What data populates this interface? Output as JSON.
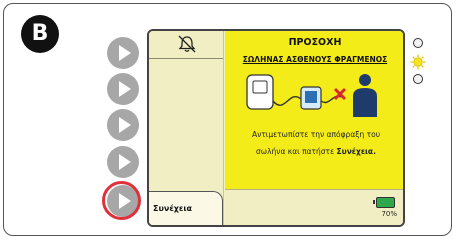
{
  "badge": {
    "letter": "B"
  },
  "screen": {
    "warning": {
      "title": "ΠΡΟΣΟΧΗ",
      "subtitle": "ΣΩΛΗΝΑΣ ΑΣΘΕΝΟΥΣ ΦΡΑΓΜΕΝΟΣ",
      "instruction_line1": "Αντιμετωπίστε την απόφραξη του",
      "instruction_line2_prefix": "σωλήνα και πατήστε ",
      "instruction_line2_bold": "Συνέχεια."
    },
    "continue_label": "Συνέχεια",
    "battery": {
      "percent": "70%",
      "level": 0.7
    }
  },
  "colors": {
    "warning_background": "#f4ec18",
    "screen_background": "#f4f1c2",
    "highlight_ring": "#e0303a",
    "battery_fill": "#2ea84a",
    "led_active": "#f6e51e",
    "block_mark": "#d9272e"
  },
  "icons": {
    "alarm": "alarm-bell-muted-icon",
    "device": "pump-device-icon",
    "canister": "canister-icon",
    "blocked": "red-x-icon",
    "patient": "patient-icon",
    "side_buttons": "play-triangle-icon"
  },
  "leds": [
    {
      "state": "off"
    },
    {
      "state": "on"
    },
    {
      "state": "off"
    }
  ]
}
